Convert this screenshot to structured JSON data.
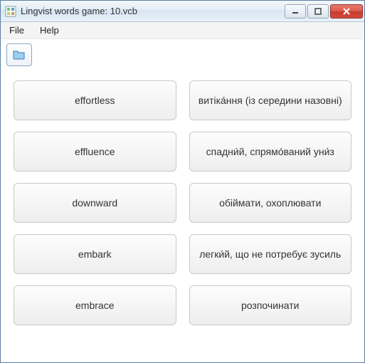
{
  "window": {
    "title": "Lingvist words game: 10.vcb"
  },
  "menu": {
    "file": "File",
    "help": "Help"
  },
  "left": {
    "0": "effortless",
    "1": "effluence",
    "2": "downward",
    "3": "embark",
    "4": "embrace"
  },
  "right": {
    "0": "витіка́ння (із середини назовні)",
    "1": "спадни́й, спрямо́ваний уни́з",
    "2": "обіймати, охоплювати",
    "3": "легки́й, що не потребує зусиль",
    "4": "розпочинати"
  }
}
